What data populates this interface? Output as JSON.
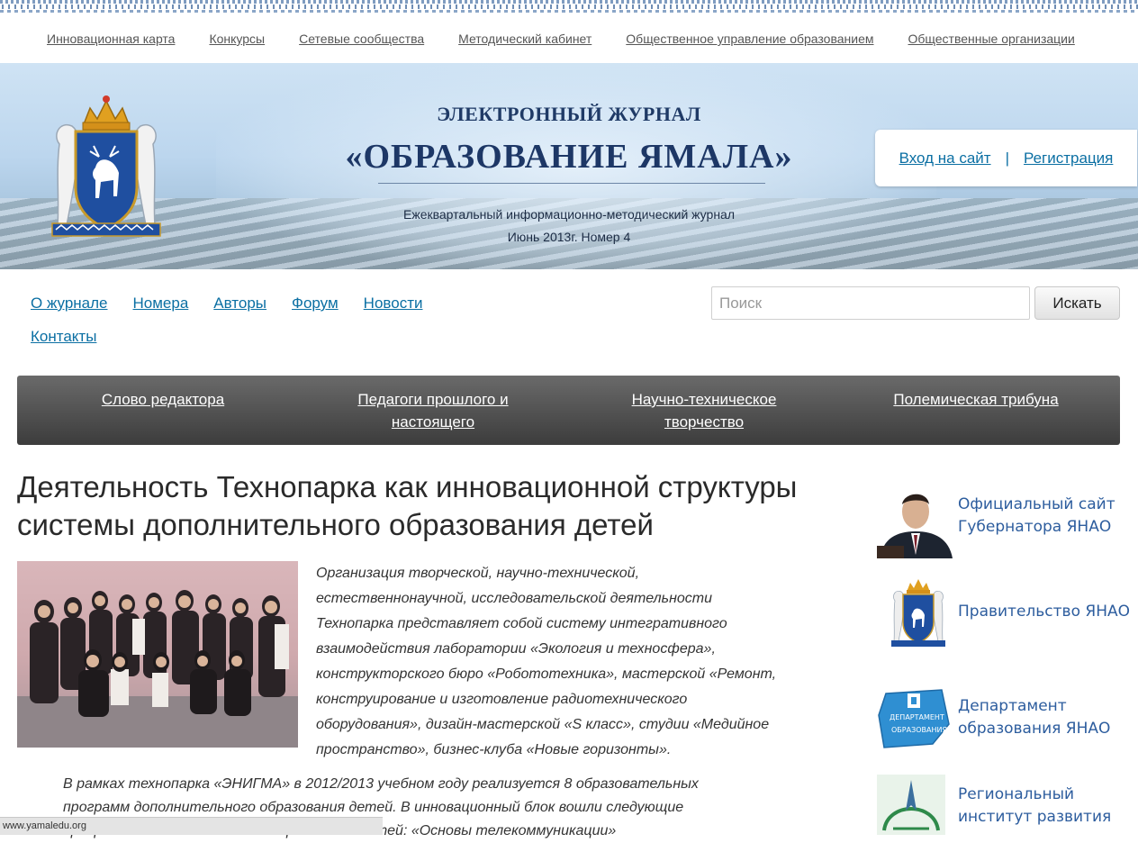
{
  "top_nav": [
    "Инновационная карта",
    "Конкурсы",
    "Сетевые сообщества",
    "Методический кабинет",
    "Общественное управление образованием",
    "Общественные организации"
  ],
  "banner": {
    "subtitle": "ЭЛЕКТРОННЫЙ ЖУРНАЛ",
    "title": "«ОБРАЗОВАНИЕ ЯМАЛА»",
    "description": "Ежеквартальный информационно-методический журнал",
    "issue": "Июнь 2013г. Номер 4"
  },
  "auth": {
    "login": "Вход на сайт",
    "separator": "|",
    "register": "Регистрация"
  },
  "main_nav": [
    "О журнале",
    "Номера",
    "Авторы",
    "Форум",
    "Новости",
    "Контакты"
  ],
  "search": {
    "placeholder": "Поиск",
    "button": "Искать"
  },
  "categories": [
    [
      "Слово редактора"
    ],
    [
      "Педагоги прошлого и",
      "настоящего"
    ],
    [
      "Научно-техническое",
      "творчество"
    ],
    [
      "Полемическая трибуна"
    ]
  ],
  "article": {
    "title_lines": [
      "Деятельность Технопарка как инновационной структуры",
      "системы дополнительного образования детей"
    ],
    "intro_lines": [
      "Организация творческой, научно-технической,",
      "естественнонаучной, исследовательской деятельности",
      "Технопарка представляет собой систему интегративного",
      "взаимодействия лаборатории «Экология и техносфера»,",
      "конструкторского бюро «Робототехника», мастерской «Ремонт,",
      "конструирование и изготовление радиотехнического",
      "оборудования», дизайн-мастерской «S класс», студии «Медийное",
      "пространство», бизнес-клуба «Новые горизонты»."
    ],
    "para_lines": [
      "В рамках технопарка «ЭНИГМА» в 2012/2013 учебном году реализуется 8 образовательных",
      "программ дополнительного образования детей. В инновационный  блок  вошли следующие",
      "программы дополнительного образования детей: «Основы телекоммуникации»"
    ]
  },
  "sidebar": [
    {
      "lines": [
        "Официальный сайт",
        "Губернатора ЯНАО"
      ]
    },
    {
      "lines": [
        "Правительство ЯНАО"
      ]
    },
    {
      "lines": [
        "Департамент",
        "образования ЯНАО"
      ],
      "badge": [
        "ДЕПАРТАМЕНТ",
        "ОБРАЗОВАНИЯ"
      ]
    },
    {
      "lines": [
        "Региональный",
        "институт развития"
      ]
    }
  ],
  "status_url": "www.yamaledu.org",
  "colors": {
    "link": "#0b6fa3",
    "sidebar_text": "#2d5d9e",
    "category_bar": "#4a4a4a",
    "banner_title": "#1d3766"
  }
}
